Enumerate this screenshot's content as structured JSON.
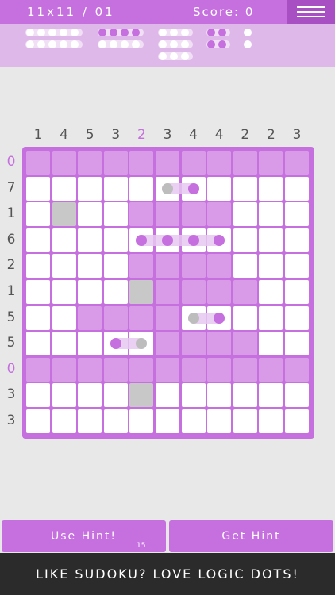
{
  "header": {
    "level": "11x11 / 01",
    "score": "Score: 0"
  },
  "col_clues": [
    "1",
    "4",
    "5",
    "3",
    "2",
    "3",
    "4",
    "4",
    "2",
    "2",
    "3"
  ],
  "row_clues": [
    "0",
    "7",
    "1",
    "6",
    "2",
    "1",
    "5",
    "5",
    "0",
    "3",
    "3"
  ],
  "highlight_col": 4,
  "board": {
    "rows": [
      "PPPPPPPPPPP",
      "WWWWWWWWWWW",
      "WGWWPPPPWWW",
      "WWWWWWWWWWW",
      "WWWWPPPPWWW",
      "WWWWGPPPPWW",
      "WWPPPPWWWWW",
      "WWWWWPPPPWW",
      "PPPPPPPPPPP",
      "WWWWGWWWWWW",
      "WWWWWWWWWWW"
    ],
    "dots": [
      {
        "r": 1,
        "c": 5,
        "color": "gray"
      },
      {
        "r": 1,
        "c": 6,
        "color": "purple"
      },
      {
        "r": 3,
        "c": 4,
        "color": "purple"
      },
      {
        "r": 3,
        "c": 5,
        "color": "purple"
      },
      {
        "r": 3,
        "c": 6,
        "color": "purple"
      },
      {
        "r": 3,
        "c": 7,
        "color": "purple"
      },
      {
        "r": 6,
        "c": 6,
        "color": "gray"
      },
      {
        "r": 6,
        "c": 7,
        "color": "purple"
      },
      {
        "r": 7,
        "c": 3,
        "color": "purple"
      },
      {
        "r": 7,
        "c": 4,
        "color": "gray"
      }
    ],
    "segments": [
      {
        "r": 1,
        "c1": 5,
        "c2": 6
      },
      {
        "r": 3,
        "c1": 4,
        "c2": 7
      },
      {
        "r": 6,
        "c1": 6,
        "c2": 7
      },
      {
        "r": 7,
        "c1": 3,
        "c2": 4
      }
    ]
  },
  "buttons": {
    "use_hint": "Use Hint!",
    "hint_count": "15",
    "get_hint": "Get Hint"
  },
  "banner": "LIKE SUDOKU? LOVE LOGIC DOTS!",
  "colors": {
    "accent": "#c66fdf",
    "cell_purple": "#d99be8",
    "cell_white": "#ffffff",
    "cell_gray": "#c8c8c8",
    "dot_purple": "#c66fdf",
    "dot_gray": "#bdbdbd"
  }
}
